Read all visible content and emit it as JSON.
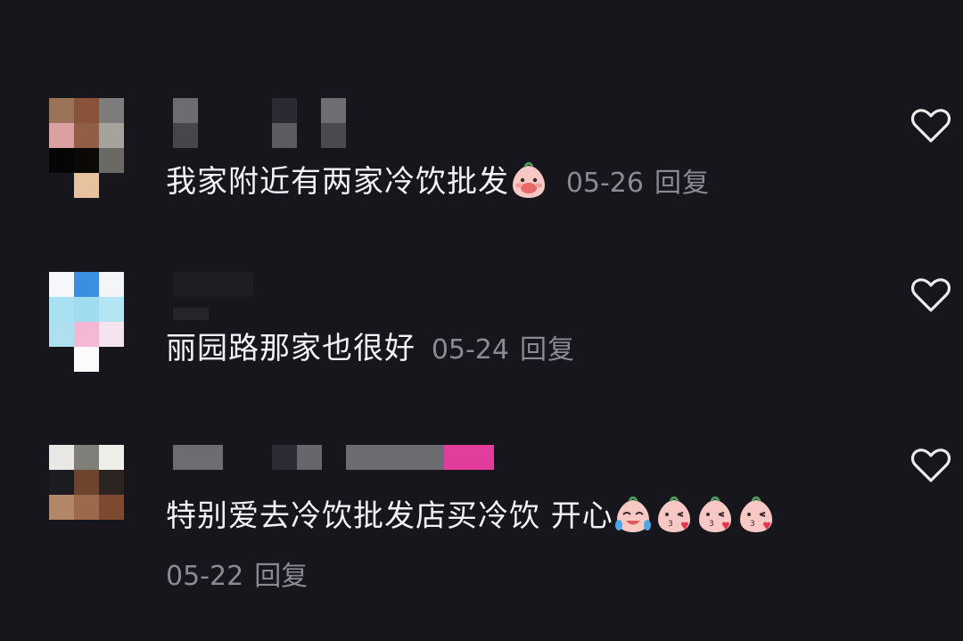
{
  "comments": [
    {
      "text": "我家附近有两家冷饮批发",
      "date": "05-26",
      "reply": "回复",
      "emoji": [
        "peach-covering-mouth"
      ]
    },
    {
      "text": "丽园路那家也很好",
      "date": "05-24",
      "reply": "回复",
      "emoji": []
    },
    {
      "text": "特别爱去冷饮批发店买冷饮 开心",
      "date": "05-22",
      "reply": "回复",
      "emoji": [
        "peach-crying-laughing",
        "peach-blowing-kiss",
        "peach-blowing-kiss",
        "peach-blowing-kiss"
      ]
    }
  ],
  "icons": {
    "like": "heart-outline-icon"
  },
  "colors": {
    "background": "#17161c",
    "text": "#f2f2f4",
    "meta": "#8b8a93",
    "name_accent": "#e23d9c"
  }
}
